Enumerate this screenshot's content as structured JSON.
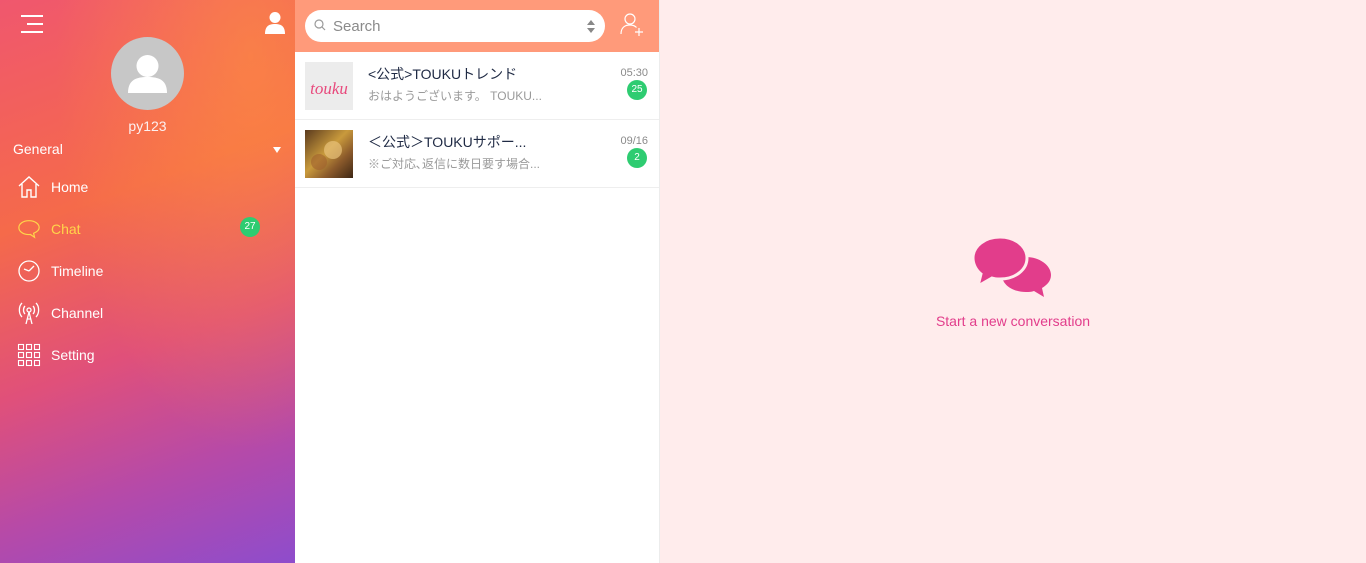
{
  "sidebar": {
    "username": "py123",
    "section": "General",
    "items": [
      {
        "label": "Home",
        "icon": "home-icon"
      },
      {
        "label": "Chat",
        "icon": "chat-bubble-icon",
        "badge": "27",
        "active": true
      },
      {
        "label": "Timeline",
        "icon": "clock-icon"
      },
      {
        "label": "Channel",
        "icon": "broadcast-antenna-icon"
      },
      {
        "label": "Setting",
        "icon": "grid-icon"
      }
    ]
  },
  "search": {
    "placeholder": "Search"
  },
  "chats": [
    {
      "name": "<公式>TOUKUトレンド",
      "preview": "おはようございます。 TOUKU...",
      "time": "05:30",
      "unread": "25",
      "thumb_text": "touku"
    },
    {
      "name": "＜公式＞TOUKUサポー...",
      "preview": "※ご対応､返信に数日要す場合...",
      "time": "09/16",
      "unread": "2"
    }
  ],
  "main": {
    "empty_text": "Start a new conversation"
  },
  "colors": {
    "accent": "#ffd54a",
    "badge": "#2ecc71",
    "header": "#ff9a7a",
    "conversation": "#e23d8b",
    "background": "#ffecec"
  }
}
